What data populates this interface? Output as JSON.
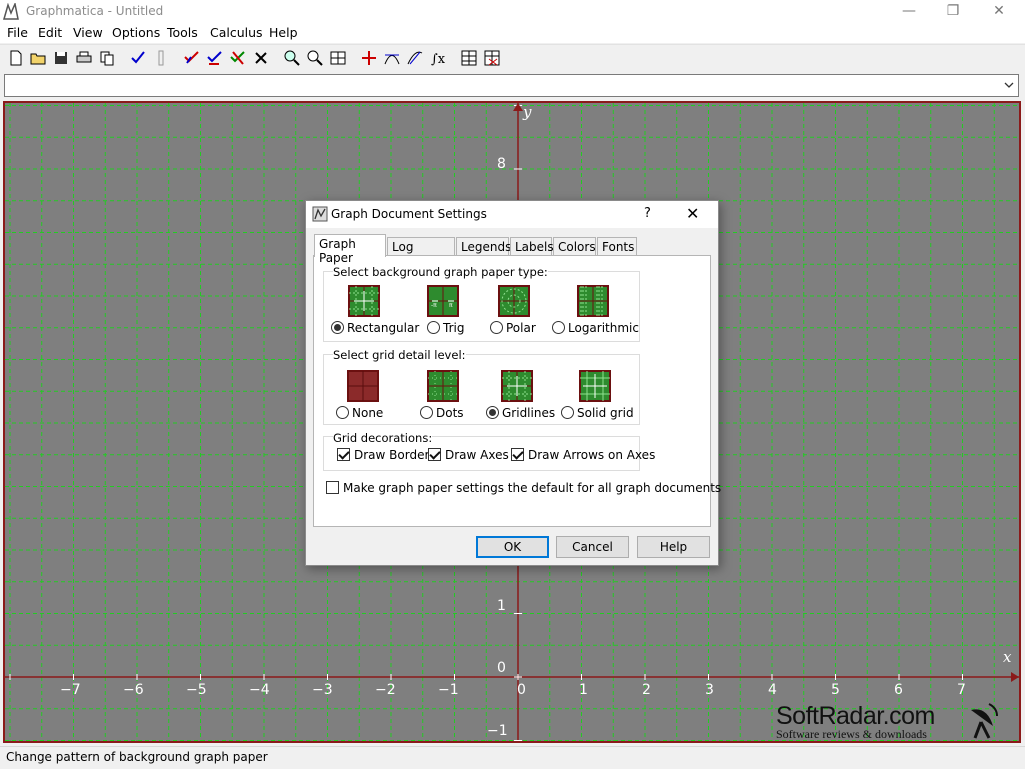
{
  "window": {
    "title": "Graphmatica - Untitled",
    "minimize": "—",
    "maximize": "❐",
    "close": "✕"
  },
  "menu": [
    "File",
    "Edit",
    "View",
    "Options",
    "Tools",
    "Calculus",
    "Help"
  ],
  "toolbar": {
    "icons": [
      "new-document-icon",
      "open-folder-icon",
      "save-icon",
      "print-icon",
      "copy-icon",
      "check-mark-icon",
      "separator-icon",
      "graph-icon",
      "graph-redraw-icon",
      "graph-clear-icon",
      "delete-icon",
      "zoom-in-icon",
      "zoom-out-icon",
      "grid-icon",
      "crosshair-icon",
      "tangent-icon",
      "derivative-icon",
      "integral-icon",
      "table-icon",
      "table-delete-icon"
    ]
  },
  "equation_input": {
    "value": "",
    "placeholder": ""
  },
  "graph": {
    "background": "#808080",
    "grid_color": "#22cc22",
    "axis_color": "#8b1a1a",
    "x_axis_label": "x",
    "y_axis_label": "y",
    "x_ticks": [
      "−7",
      "−6",
      "−5",
      "−4",
      "−3",
      "−2",
      "−1",
      "0",
      "1",
      "2",
      "3",
      "4",
      "5",
      "6",
      "7"
    ],
    "y_ticks": [
      "8",
      "1",
      "−1"
    ],
    "origin_label": "0"
  },
  "watermark": {
    "main": "SoftRadar.com",
    "sub": "Software reviews & downloads"
  },
  "status": "Change pattern of background graph paper",
  "dialog": {
    "title": "Graph Document Settings",
    "help_glyph": "?",
    "close_glyph": "✕",
    "tabs": [
      "Graph Paper",
      "Log Options",
      "Legends",
      "Labels",
      "Colors",
      "Fonts"
    ],
    "active_tab": "Graph Paper",
    "paper_type": {
      "label": "Select background graph paper type:",
      "options": [
        "Rectangular",
        "Trig",
        "Polar",
        "Logarithmic"
      ],
      "selected": "Rectangular"
    },
    "grid_detail": {
      "label": "Select grid detail level:",
      "options": [
        "None",
        "Dots",
        "Gridlines",
        "Solid grid"
      ],
      "selected": "Gridlines"
    },
    "decorations": {
      "label": "Grid decorations:",
      "draw_border": "Draw Border",
      "draw_axes": "Draw Axes",
      "draw_arrows": "Draw Arrows on Axes",
      "draw_border_checked": true,
      "draw_axes_checked": true,
      "draw_arrows_checked": true
    },
    "default_checkbox": {
      "label": "Make graph paper settings the default for all graph documents",
      "checked": false
    },
    "buttons": {
      "ok": "OK",
      "cancel": "Cancel",
      "help": "Help"
    }
  }
}
